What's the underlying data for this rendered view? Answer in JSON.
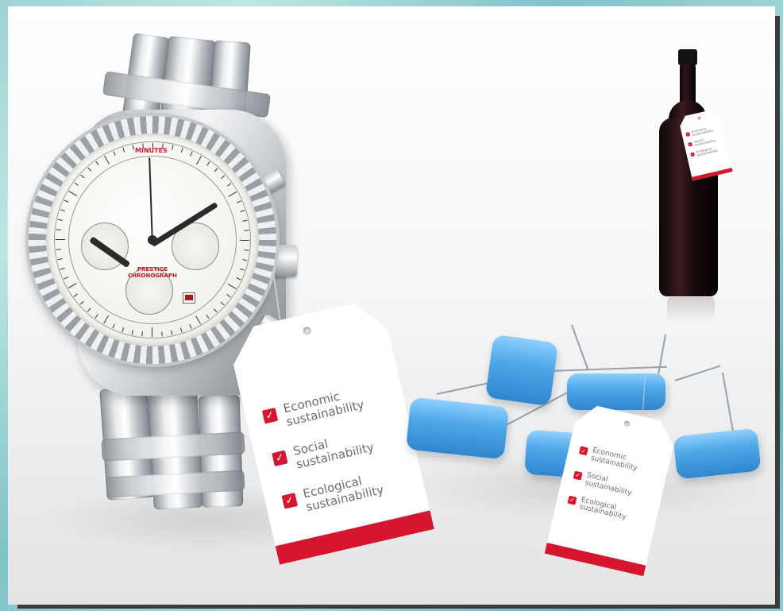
{
  "tag_lines": [
    "Economic sustainability",
    "Social sustainability",
    "Ecological sustainability"
  ],
  "tags": {
    "large": {
      "line1a": "Economic",
      "line1b": "sustainability",
      "line2a": "Social",
      "line2b": "sustainability",
      "line3a": "Ecological",
      "line3b": "sustainability"
    },
    "medium": {
      "line1a": "Economic",
      "line1b": "sustainability",
      "line2a": "Social",
      "line2b": "sustainability",
      "line3a": "Ecological",
      "line3b": "sustainability"
    },
    "small": {
      "line1a": "Economic",
      "line1b": "sustainability",
      "line2a": "Social",
      "line2b": "sustainability",
      "line3a": "Ecological",
      "line3b": "sustainability"
    }
  },
  "watch": {
    "dial_text_1": "PRESTIGE",
    "dial_text_2": "CHRONOGRAPH",
    "minutes_label": "MINUTES"
  },
  "check_mark": "✓",
  "colors": {
    "accent_red": "#d6152e",
    "capacitor_blue": "#4fa8e8",
    "background_teal": "#9fd3d6"
  },
  "icons": [
    "check-icon",
    "watch-icon",
    "bottle-icon",
    "capacitor-icon"
  ]
}
